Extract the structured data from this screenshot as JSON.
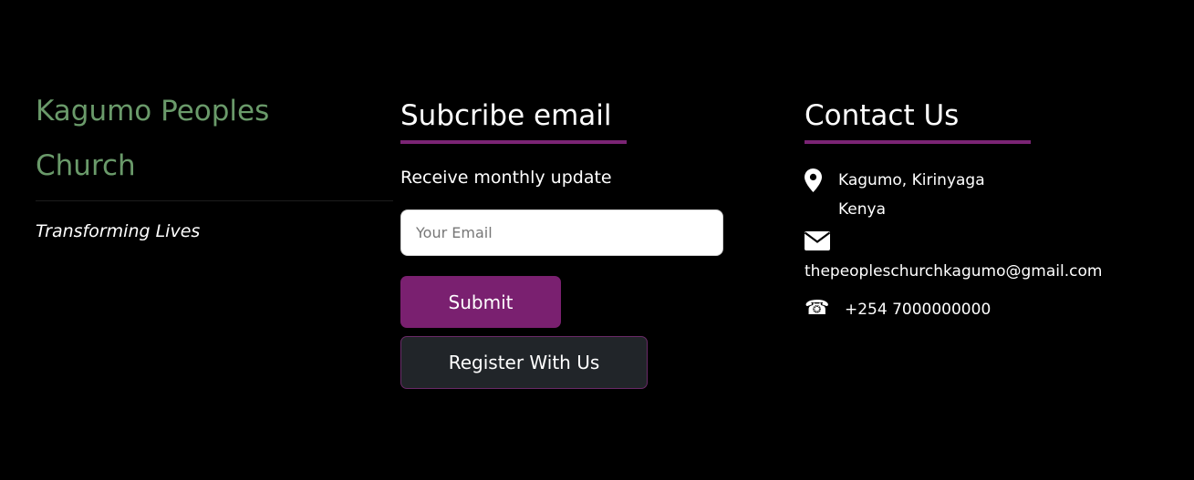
{
  "brand": {
    "title": "Kagumo Peoples Church",
    "tagline": "Transforming Lives"
  },
  "subscribe": {
    "heading": "Subcribe email",
    "description": "Receive monthly update",
    "email_placeholder": "Your Email",
    "email_value": "",
    "submit_label": "Submit",
    "register_label": "Register With Us"
  },
  "contact": {
    "heading": "Contact Us",
    "address_line1": "Kagumo, Kirinyaga",
    "address_line2": "Kenya",
    "email": "thepeopleschurchkagumo@gmail.com",
    "phone": "+254 7000000000",
    "icons": {
      "address": "map-marker-icon",
      "email": "envelope-icon",
      "phone": "telephone-icon"
    }
  },
  "colors": {
    "background": "#000000",
    "brand_green": "#6a9a6a",
    "accent_purple": "#7a2070",
    "register_bg": "#212529"
  }
}
